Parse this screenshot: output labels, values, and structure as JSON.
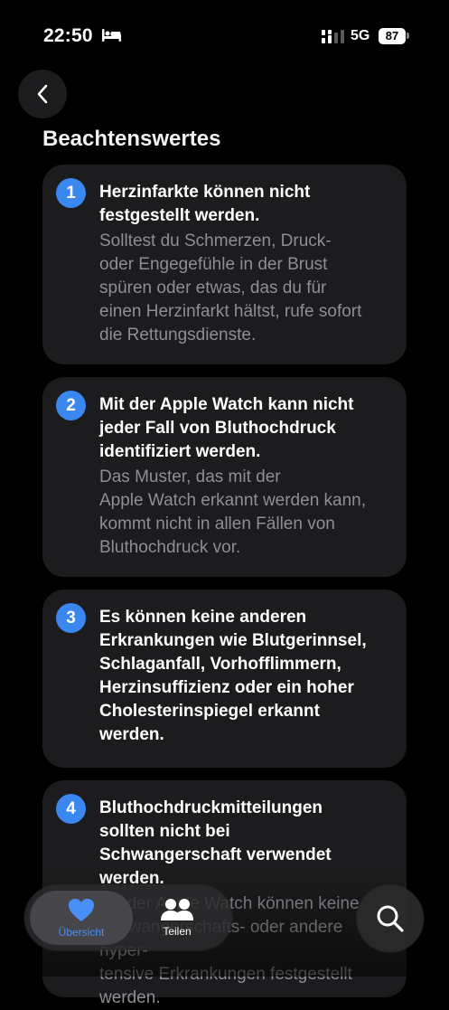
{
  "status_bar": {
    "time": "22:50",
    "network": "5G",
    "battery": "87"
  },
  "header": {
    "title": "Beachtenswertes"
  },
  "cards": [
    {
      "number": "1",
      "title": "Herzinfarkte können nicht\nfestgestellt werden.",
      "body": "Solltest du Schmerzen, Druck-\noder Engegefühle in der Brust\nspüren oder etwas, das du für\neinen Herzinfarkt hältst, rufe sofort\ndie Rettungsdienste."
    },
    {
      "number": "2",
      "title": "Mit der Apple Watch kann nicht\njeder Fall von Bluthochdruck\nidentifiziert werden.",
      "body": "Das Muster, das mit der\nApple Watch erkannt werden kann,\nkommt nicht in allen Fällen von\nBluthochdruck vor."
    },
    {
      "number": "3",
      "title": "Es können keine anderen\nErkrankungen wie Blutgerinnsel,\nSchlaganfall, Vorhofflimmern,\nHerzinsuffizienz oder ein hoher\nCholesterinspiegel erkannt\nwerden.",
      "body": ""
    },
    {
      "number": "4",
      "title": "Bluthochdruckmitteilungen\nsollten nicht bei\nSchwangerschaft verwendet\nwerden.",
      "body": "Mit der Apple Watch können keine\nSchwangerschafts- oder andere hyper-\ntensive Erkrankungen festgestellt\nwerden."
    }
  ],
  "tabbar": {
    "items": [
      {
        "label": "Übersicht",
        "icon": "heart-icon",
        "active": true
      },
      {
        "label": "Teilen",
        "icon": "people-icon",
        "active": false
      }
    ],
    "search_icon": "search-icon"
  },
  "colors": {
    "accent": "#3a87f0",
    "card": "#1c1c1e",
    "active_tab_text": "#4a8ef7"
  }
}
